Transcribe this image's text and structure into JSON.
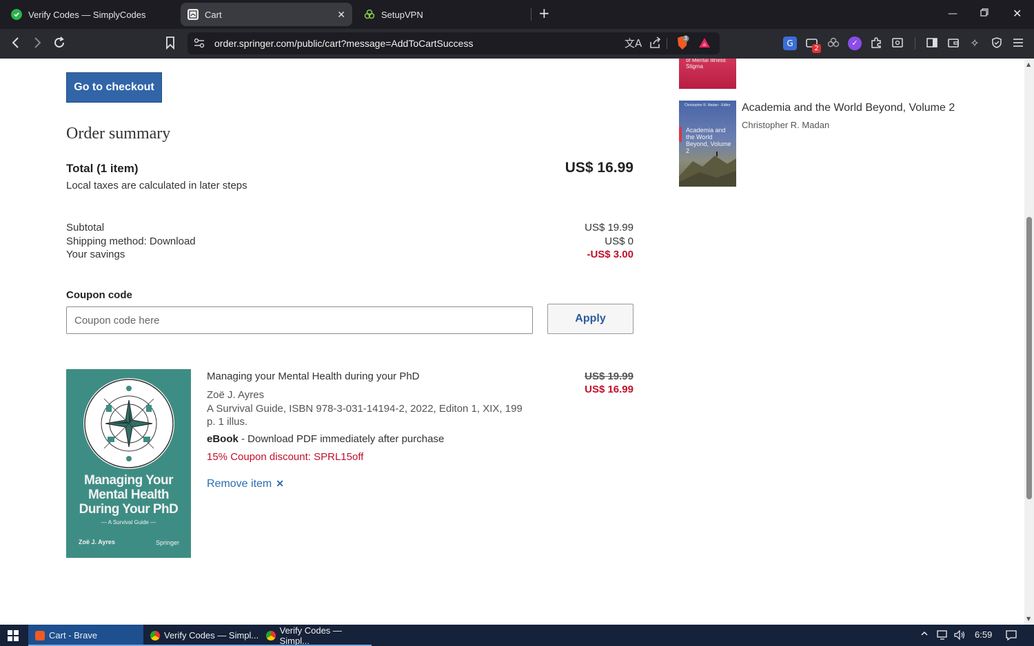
{
  "browser": {
    "tabs": [
      {
        "title": "Verify Codes — SimplyCodes",
        "icon": "simplycodes-icon"
      },
      {
        "title": "Cart",
        "icon": "springer-icon",
        "active": true
      },
      {
        "title": "SetupVPN",
        "icon": "vpn-icon"
      }
    ],
    "url": "order.springer.com/public/cart?message=AddToCartSuccess",
    "brave_badge": "3",
    "ext_badge": "2"
  },
  "page": {
    "checkout_label": "Go to checkout",
    "summary_title": "Order summary",
    "total_label": "Total (1 item)",
    "total_price": "US$ 16.99",
    "tax_note": "Local taxes are calculated in later steps",
    "breakdown": {
      "subtotal_label": "Subtotal",
      "subtotal_value": "US$ 19.99",
      "shipping_label": "Shipping method: Download",
      "shipping_value": "US$ 0",
      "savings_label": "Your savings",
      "savings_value": "-US$ 3.00"
    },
    "coupon": {
      "label": "Coupon code",
      "placeholder": "Coupon code here",
      "apply_label": "Apply"
    },
    "item": {
      "title": "Managing your Mental Health during your PhD",
      "author": "Zoë J. Ayres",
      "details": "A Survival Guide, ISBN 978-3-031-14194-2, 2022, Editon 1, XIX, 199 p. 1 illus.",
      "format_bold": "eBook",
      "format_rest": " - Download PDF immediately after purchase",
      "discount": "15% Coupon discount: SPRL15off",
      "remove_label": "Remove item",
      "old_price": "US$ 19.99",
      "new_price": "US$ 16.99",
      "cover": {
        "title_line1": "Managing Your",
        "title_line2": "Mental Health",
        "title_line3": "During Your PhD",
        "subtitle": "— A Survival Guide —",
        "author": "Zoë J. Ayres",
        "publisher": "Springer"
      }
    },
    "recommendations": [
      {
        "cover_text": "of Mental Illness Stigma"
      },
      {
        "title": "Academia and the World Beyond, Volume 2",
        "author": "Christopher R. Madan",
        "cover_author": "Christopher R. Madan · Editor",
        "cover_title": "Academia and the World Beyond, Volume 2"
      }
    ]
  },
  "taskbar": {
    "items": [
      {
        "label": "Cart - Brave"
      },
      {
        "label": "Verify Codes — Simpl..."
      },
      {
        "label": "Verify Codes — Simpl..."
      }
    ],
    "time": "6:59"
  },
  "colors": {
    "accent_blue": "#3165a8",
    "discount_red": "#c0102c",
    "link_blue": "#2b6db0",
    "cover_teal": "#3e8d84"
  }
}
